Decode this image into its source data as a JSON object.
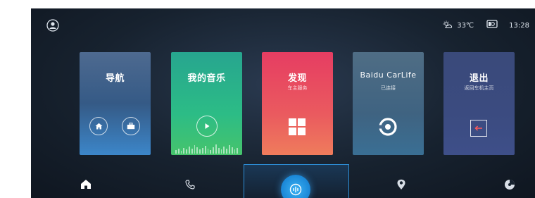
{
  "status": {
    "temperature": "33℃",
    "time": "13:28"
  },
  "cards": {
    "nav": {
      "title": "导航"
    },
    "music": {
      "title": "我的音乐"
    },
    "discover": {
      "title": "发现",
      "subtitle": "车主服务"
    },
    "carlife": {
      "title": "Baidu CarLife",
      "subtitle": "已连接"
    },
    "exit": {
      "title": "退出",
      "subtitle": "返回车机主页"
    }
  },
  "dock": {
    "items": [
      "home-icon",
      "phone-icon",
      "voice-icon",
      "location-icon",
      "media-icon"
    ],
    "active": "voice-icon"
  },
  "colors": {
    "accent": "#2d8fd8",
    "nav_card": "#3c6fa8",
    "music_card": "#2cb98a",
    "discover_card": "#e8475f",
    "carlife_card": "#45688a",
    "exit_card": "#3b4b80"
  },
  "icons": {
    "topbar": [
      "user-avatar-icon",
      "weather-icon",
      "screen-cast-icon"
    ],
    "nav_card": [
      "home-icon",
      "briefcase-icon"
    ],
    "music_card": [
      "play-icon",
      "audio-bars"
    ],
    "discover_card": [
      "grid-icon"
    ],
    "carlife_card": [
      "carlife-logo-icon"
    ],
    "exit_card": [
      "exit-arrow-icon"
    ]
  }
}
